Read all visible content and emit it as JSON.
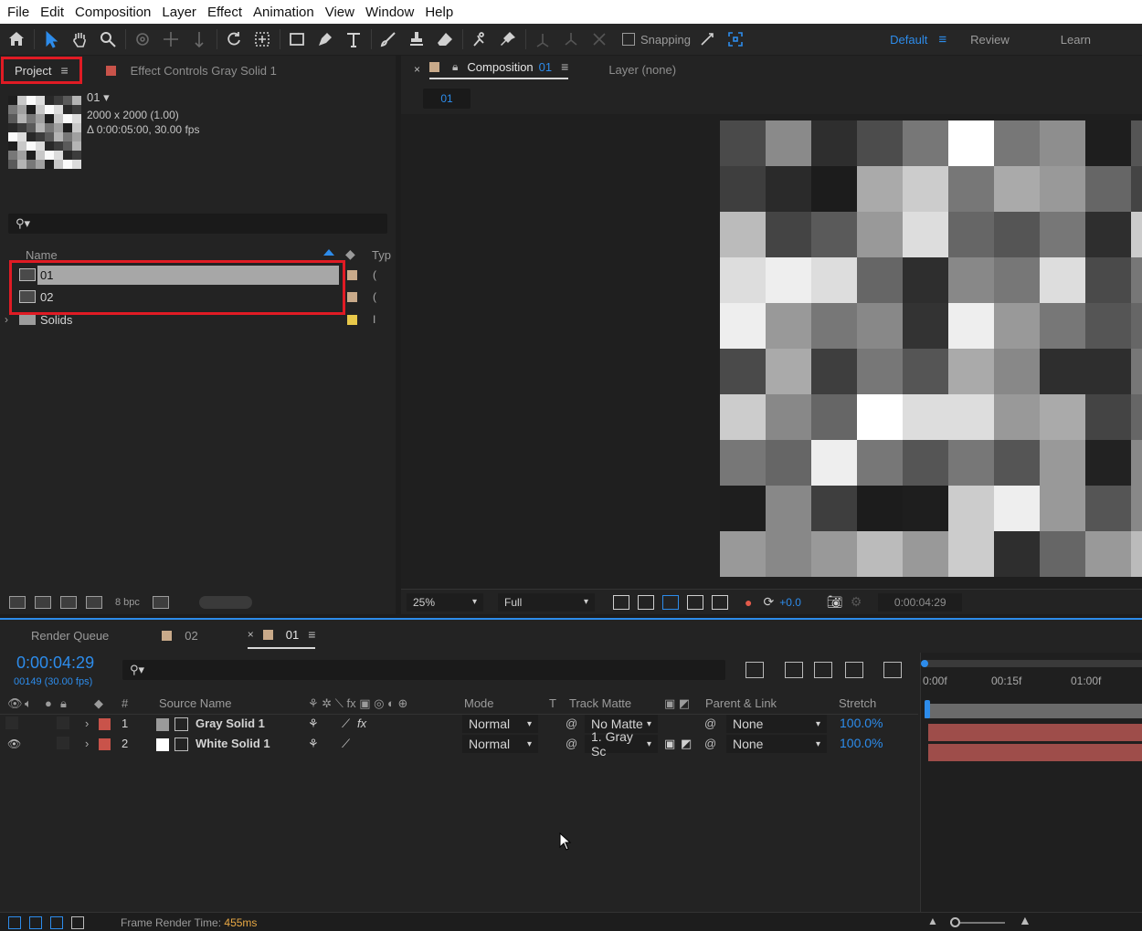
{
  "menu": [
    "File",
    "Edit",
    "Composition",
    "Layer",
    "Effect",
    "Animation",
    "View",
    "Window",
    "Help"
  ],
  "toolbar": {
    "snapping_label": "Snapping",
    "workspaces": [
      "Default",
      "Review",
      "Learn"
    ],
    "active_workspace": "Default"
  },
  "project": {
    "tab_label": "Project",
    "effect_controls_label": "Effect Controls",
    "effect_controls_target": "Gray Solid 1",
    "selected_name": "01",
    "dimensions": "2000 x 2000 (1.00)",
    "duration": "Δ 0:00:05:00, 30.00 fps",
    "col_name": "Name",
    "col_type": "Typ",
    "items": [
      {
        "name": "01",
        "type": "(",
        "label_color": "#c9aa8a",
        "selected": true
      },
      {
        "name": "02",
        "type": "(",
        "label_color": "#c9aa8a",
        "selected": false
      },
      {
        "name": "Solids",
        "type": "I",
        "label_color": "#e8c84a",
        "selected": false
      }
    ],
    "bpc": "8 bpc"
  },
  "composition": {
    "tab_label": "Composition",
    "tab_name": "01",
    "layer_label": "Layer (none)",
    "sub_tab": "01",
    "zoom": "25%",
    "resolution": "Full",
    "exposure": "+0.0",
    "timecode": "0:00:04:29"
  },
  "timeline": {
    "render_queue_label": "Render Queue",
    "tabs": [
      "02",
      "01"
    ],
    "current_time": "0:00:04:29",
    "frames": "00149 (30.00 fps)",
    "columns": {
      "number": "#",
      "source_name": "Source Name",
      "mode": "Mode",
      "t": "T",
      "track_matte": "Track Matte",
      "parent": "Parent & Link",
      "stretch": "Stretch"
    },
    "ruler": [
      "0:00f",
      "00:15f",
      "01:00f"
    ],
    "layers": [
      {
        "index": "1",
        "name": "Gray Solid 1",
        "swatch": "#9a9a9a",
        "mode": "Normal",
        "track_matte": "No Matte",
        "parent": "None",
        "stretch": "100.0%",
        "visible": false
      },
      {
        "index": "2",
        "name": "White Solid 1",
        "swatch": "#ffffff",
        "mode": "Normal",
        "track_matte": "1. Gray Sc",
        "parent": "None",
        "stretch": "100.0%",
        "visible": true
      }
    ],
    "frame_render_label": "Frame Render Time:",
    "frame_render_value": "455ms"
  }
}
